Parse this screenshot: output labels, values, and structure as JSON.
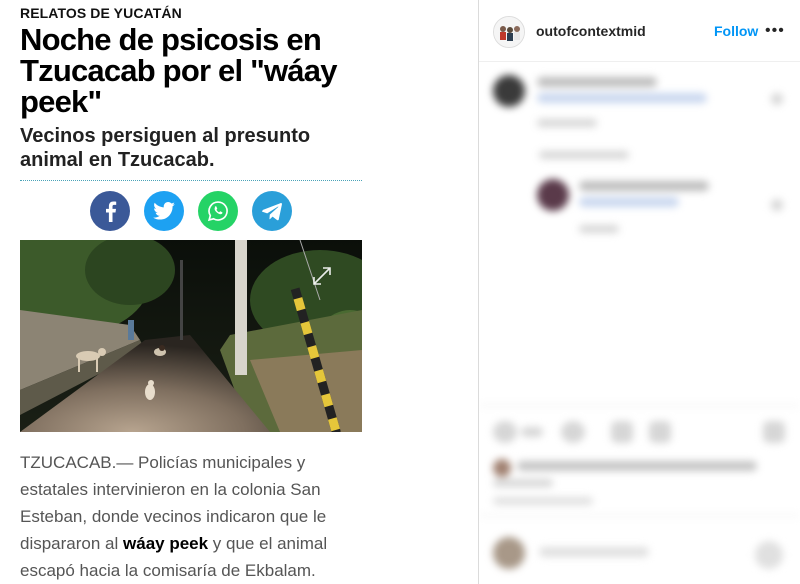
{
  "article": {
    "section": "RELATOS DE YUCATÁN",
    "headline": "Noche de psicosis en Tzucacab por el \"wáay peek\"",
    "subheadline": "Vecinos persiguen al presunto animal en Tzucacab.",
    "body_before": "TZUCACAB.— Policías municipales y estatales intervinieron en la colonia San Esteban, donde vecinos indicaron que le dispararon al ",
    "body_bold": "wáay peek",
    "body_after": " y que el animal escapó hacia la comisaría de Ekbalam.",
    "share_buttons": [
      {
        "name": "facebook",
        "icon": "facebook-icon",
        "color": "#3b5998"
      },
      {
        "name": "twitter",
        "icon": "twitter-icon",
        "color": "#1da1f2"
      },
      {
        "name": "whatsapp",
        "icon": "whatsapp-icon",
        "color": "#25d366"
      },
      {
        "name": "telegram",
        "icon": "telegram-icon",
        "color": "#2a9fd9"
      }
    ]
  },
  "instagram": {
    "username": "outofcontextmid",
    "follow_label": "Follow",
    "more_icon": "•••",
    "accent_color": "#0095f6"
  }
}
